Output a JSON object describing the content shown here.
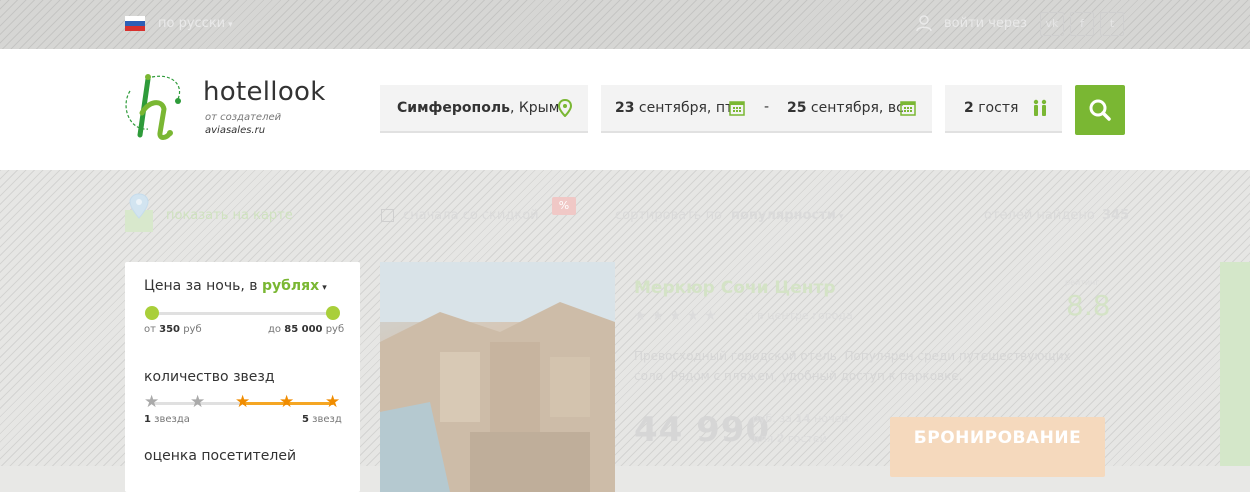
{
  "topbar": {
    "language": "по русски",
    "login": "войти через",
    "socials": [
      "vk-icon",
      "facebook-icon",
      "twitter-icon"
    ],
    "flag_colors": [
      "#ffffff",
      "#2d5fb6",
      "#d8302d"
    ]
  },
  "header": {
    "brand": "hotellook",
    "sub1": "от создателей",
    "sub2": "aviasales.ru",
    "city_bold": "Симферополь",
    "city_rest": ", Крым",
    "checkin_day": "23",
    "checkin_rest": " сентября, пт",
    "dash": "-",
    "checkout_day": "25",
    "checkout_rest": " сентября, вс",
    "guests_num": "2",
    "guests_rest": " гостя",
    "accent": "#7ab733"
  },
  "filters": {
    "map_link": "показать на карте",
    "discount_label": "сначала со скидкой",
    "sort_label": "сортировать по",
    "sort_value": "популярности",
    "found_label": "отелей найдено",
    "found_count": "345"
  },
  "sidebar": {
    "price_prefix": "Цена за ночь, в",
    "price_currency": "рублях",
    "price_from_label": "от",
    "price_from": "350",
    "price_unit": "руб",
    "price_to_label": "до",
    "price_to": "85 000",
    "stars_title": "количество звезд",
    "stars_min": "1",
    "stars_min_label": "звезда",
    "stars_max": "5",
    "stars_max_label": "звезд",
    "stars_selected_from": 3,
    "rating_title": "оценка посетителей"
  },
  "hotel": {
    "name": "Меркюр Сочи Центр",
    "stars": "★★★★★",
    "location": "в центре города",
    "rating_label": "рейтинг",
    "rating": "8.8",
    "description": "Превосходный городской отель. Популярен среди путешествующих соло. Рядом с пляжем, удобный доступ к парковке.",
    "price": "44 990",
    "price_info1_a": "руб. за ",
    "price_info1_b": "14",
    "price_info1_c": " ночей",
    "price_info2_a": "для ",
    "price_info2_b": "2",
    "price_info2_c": " гостей",
    "book": "БРОНИРОВАНИЕ"
  }
}
